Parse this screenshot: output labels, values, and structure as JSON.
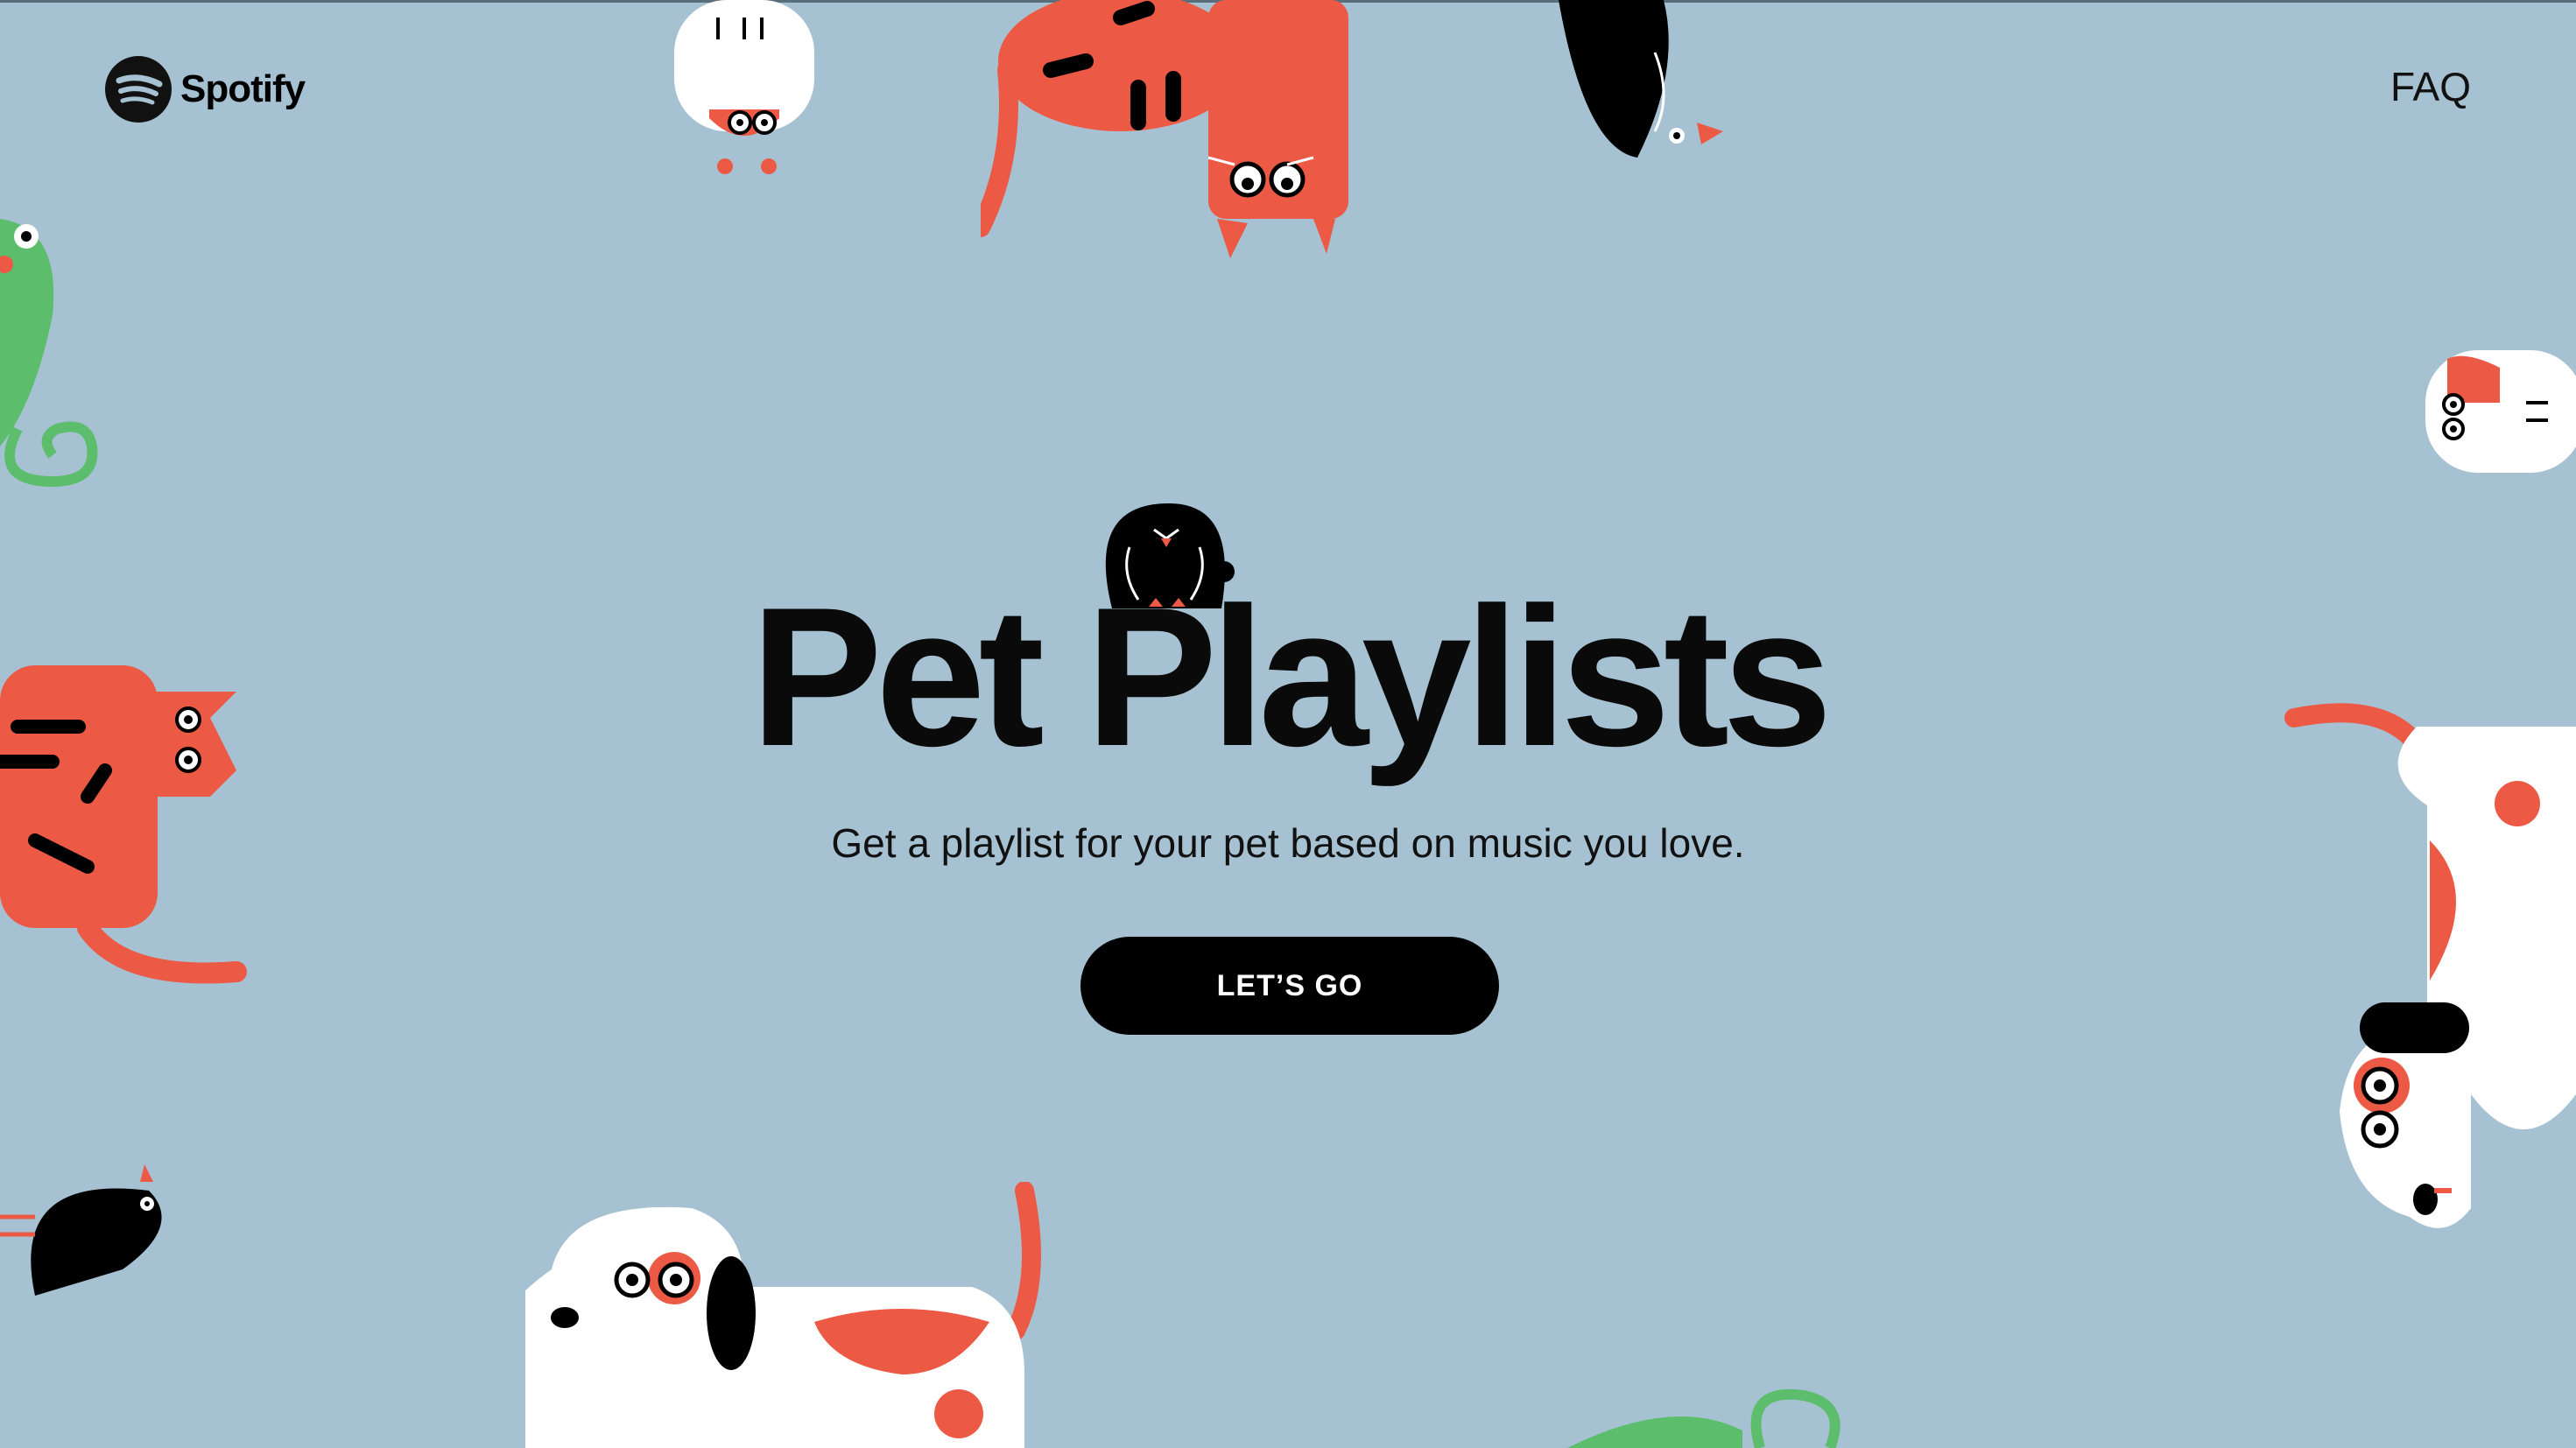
{
  "brand": {
    "name": "Spotify",
    "icon": "spotify-logo-icon"
  },
  "nav": {
    "faq_label": "FAQ"
  },
  "hero": {
    "title": "Pet Playlists",
    "subtitle": "Get a playlist for your pet based on music you love.",
    "cta_label": "LET’S GO"
  },
  "colors": {
    "background": "#a6c2d2",
    "accent_red": "#ec5a46",
    "accent_green": "#5cbe6d",
    "ink": "#000000",
    "white": "#ffffff"
  },
  "illustrations": [
    "hamster-illustration",
    "cat-illustration",
    "bird-illustration",
    "iguana-illustration",
    "dog-illustration"
  ]
}
